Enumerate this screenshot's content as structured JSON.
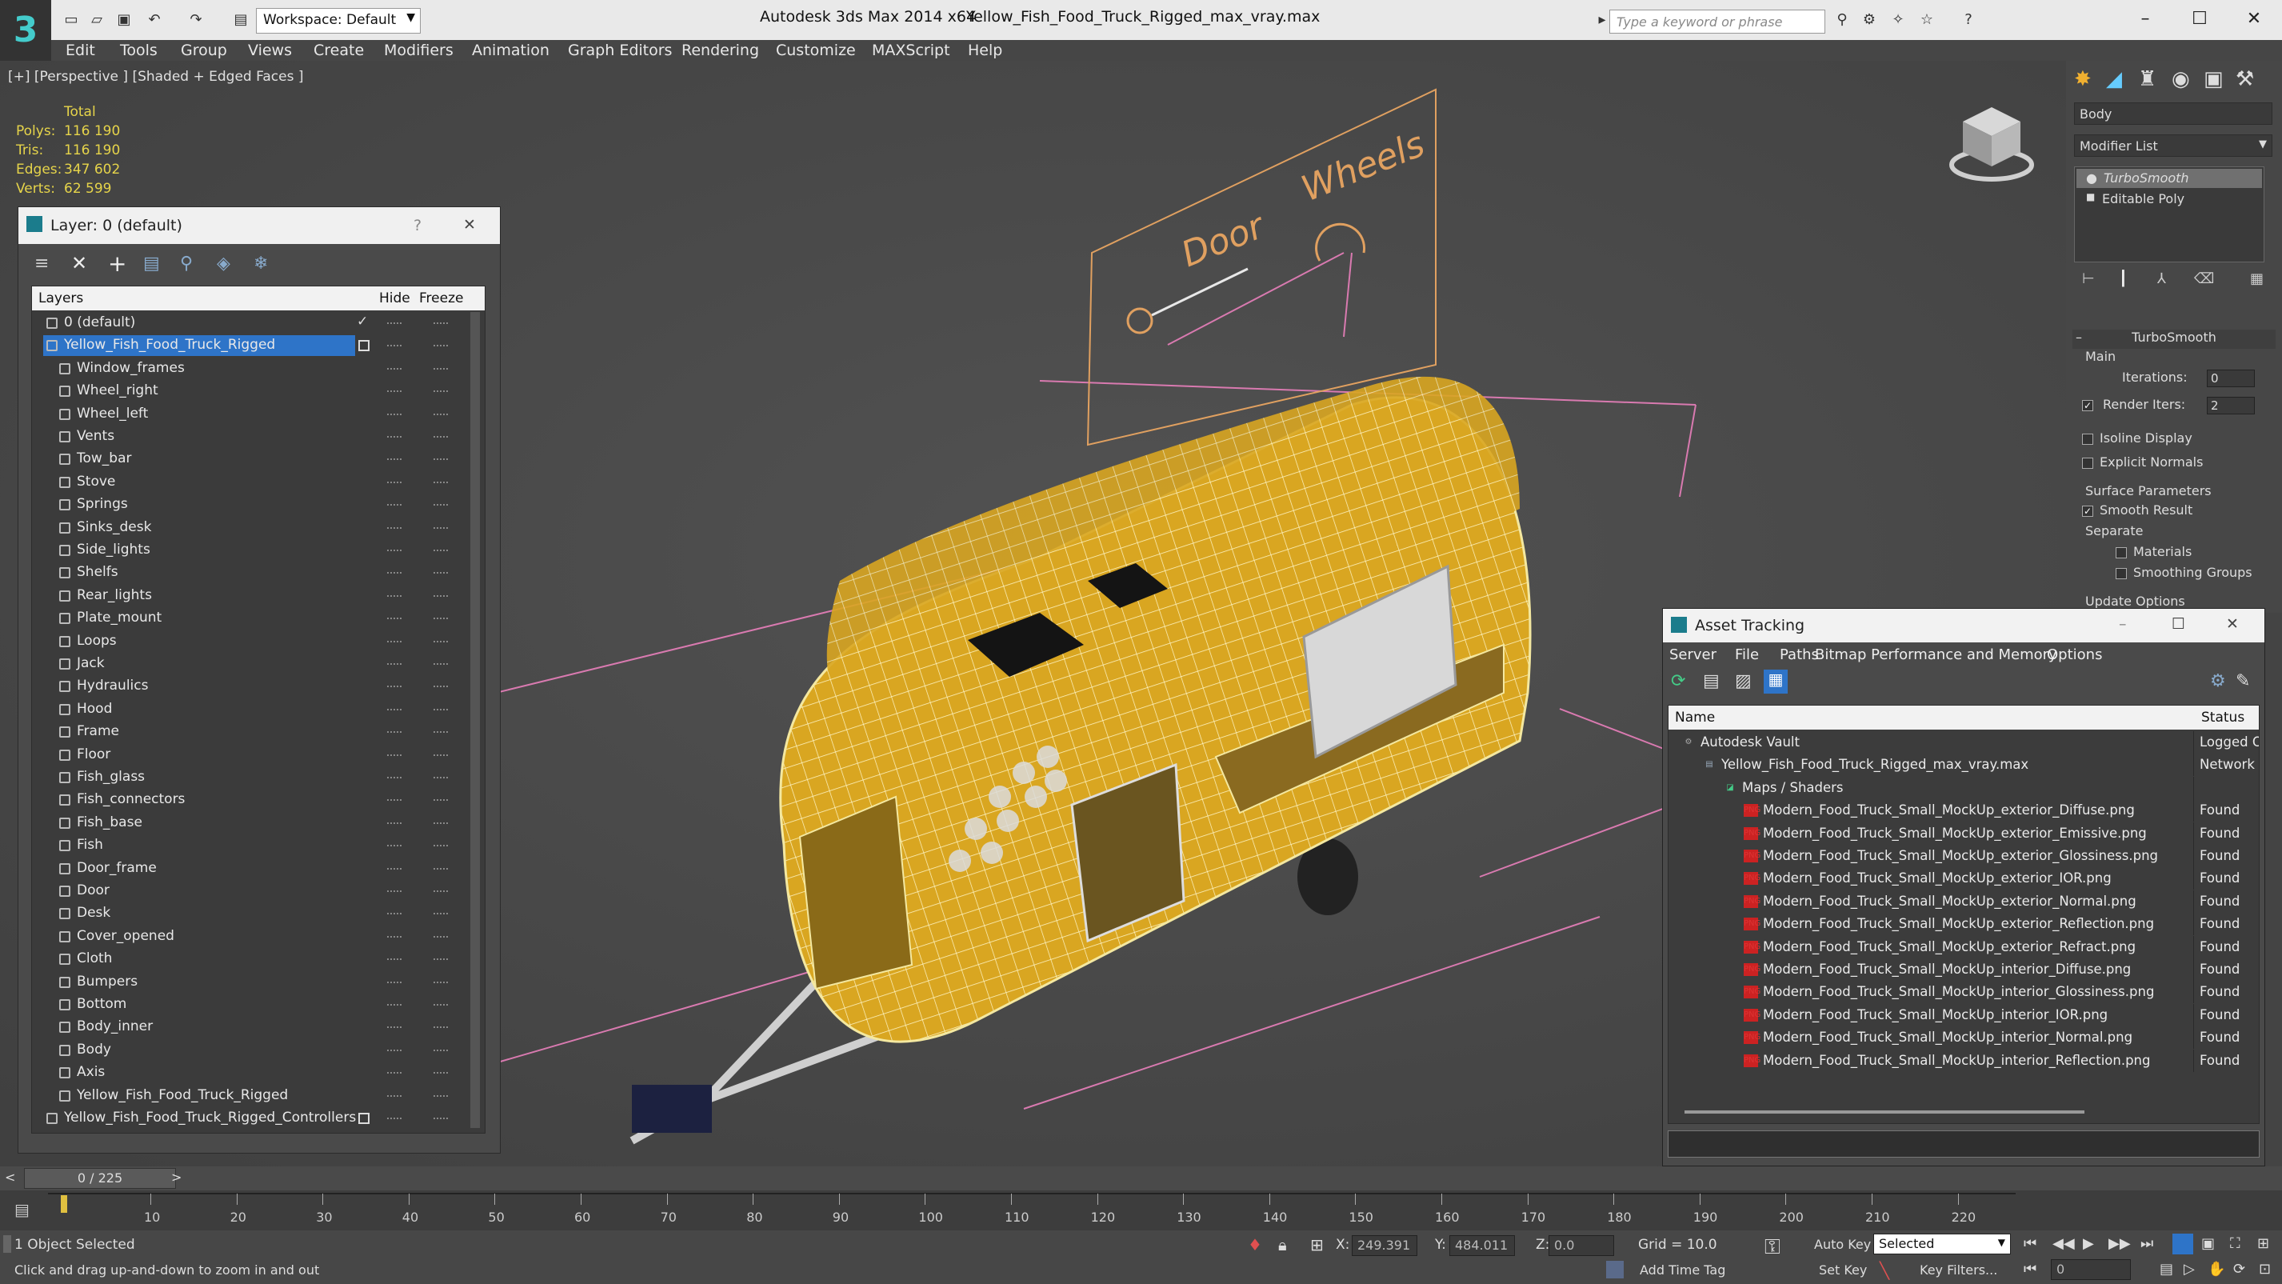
{
  "title_bar": {
    "app": "Autodesk 3ds Max  2014 x64",
    "file": "Yellow_Fish_Food_Truck_Rigged_max_vray.max",
    "workspace": "Workspace: Default",
    "search_placeholder": "Type a keyword or phrase"
  },
  "menu": [
    "Edit",
    "Tools",
    "Group",
    "Views",
    "Create",
    "Modifiers",
    "Animation",
    "Graph Editors",
    "Rendering",
    "Customize",
    "MAXScript",
    "Help"
  ],
  "viewport": {
    "label": "[+] [Perspective ] [Shaded + Edged Faces ]",
    "stats_header": "Total",
    "stats": [
      {
        "k": "Polys:",
        "v": "116 190"
      },
      {
        "k": "Tris:",
        "v": "116 190"
      },
      {
        "k": "Edges:",
        "v": "347 602"
      },
      {
        "k": "Verts:",
        "v": "62 599"
      }
    ],
    "sign_door": "Door",
    "sign_wheels": "Wheels"
  },
  "layer_dialog": {
    "title": "Layer: 0 (default)",
    "help": "?",
    "close": "✕",
    "col_layers": "Layers",
    "col_hide": "Hide",
    "col_freeze": "Freeze",
    "rows": [
      {
        "name": "0 (default)",
        "level": 0,
        "check": "✓"
      },
      {
        "name": "Yellow_Fish_Food_Truck_Rigged",
        "level": 0,
        "selected": true
      },
      {
        "name": "Window_frames",
        "level": 1
      },
      {
        "name": "Wheel_right",
        "level": 1
      },
      {
        "name": "Wheel_left",
        "level": 1
      },
      {
        "name": "Vents",
        "level": 1
      },
      {
        "name": "Tow_bar",
        "level": 1
      },
      {
        "name": "Stove",
        "level": 1
      },
      {
        "name": "Springs",
        "level": 1
      },
      {
        "name": "Sinks_desk",
        "level": 1
      },
      {
        "name": "Side_lights",
        "level": 1
      },
      {
        "name": "Shelfs",
        "level": 1
      },
      {
        "name": "Rear_lights",
        "level": 1
      },
      {
        "name": "Plate_mount",
        "level": 1
      },
      {
        "name": "Loops",
        "level": 1
      },
      {
        "name": "Jack",
        "level": 1
      },
      {
        "name": "Hydraulics",
        "level": 1
      },
      {
        "name": "Hood",
        "level": 1
      },
      {
        "name": "Frame",
        "level": 1
      },
      {
        "name": "Floor",
        "level": 1
      },
      {
        "name": "Fish_glass",
        "level": 1
      },
      {
        "name": "Fish_connectors",
        "level": 1
      },
      {
        "name": "Fish_base",
        "level": 1
      },
      {
        "name": "Fish",
        "level": 1
      },
      {
        "name": "Door_frame",
        "level": 1
      },
      {
        "name": "Door",
        "level": 1
      },
      {
        "name": "Desk",
        "level": 1
      },
      {
        "name": "Cover_opened",
        "level": 1
      },
      {
        "name": "Cloth",
        "level": 1
      },
      {
        "name": "Bumpers",
        "level": 1
      },
      {
        "name": "Bottom",
        "level": 1
      },
      {
        "name": "Body_inner",
        "level": 1
      },
      {
        "name": "Body",
        "level": 1
      },
      {
        "name": "Axis",
        "level": 1
      },
      {
        "name": "Yellow_Fish_Food_Truck_Rigged",
        "level": 1
      },
      {
        "name": "Yellow_Fish_Food_Truck_Rigged_Controllers",
        "level": 0
      }
    ]
  },
  "command_panel": {
    "object_name": "Body",
    "modifier_list": "Modifier List",
    "stack": [
      "TurboSmooth",
      "Editable Poly"
    ],
    "rollout_title": "TurboSmooth",
    "main_label": "Main",
    "iterations_label": "Iterations:",
    "iterations_value": "0",
    "render_iters_label": "Render Iters:",
    "render_iters_value": "2",
    "isoline": "Isoline Display",
    "explicit_normals": "Explicit Normals",
    "surface_params": "Surface Parameters",
    "smooth_result": "Smooth Result",
    "separate": "Separate",
    "materials": "Materials",
    "smoothing_groups": "Smoothing Groups",
    "update_options": "Update Options"
  },
  "asset_tracking": {
    "title": "Asset Tracking",
    "menu": [
      "Server",
      "File",
      "Paths",
      "Bitmap Performance and Memory",
      "Options"
    ],
    "col_name": "Name",
    "col_status": "Status",
    "rows": [
      {
        "name": "Autodesk Vault",
        "status": "Logged O",
        "level": 0
      },
      {
        "name": "Yellow_Fish_Food_Truck_Rigged_max_vray.max",
        "status": "Network P",
        "level": 1
      },
      {
        "name": "Maps / Shaders",
        "status": "",
        "level": 2
      },
      {
        "name": "Modern_Food_Truck_Small_MockUp_exterior_Diffuse.png",
        "status": "Found",
        "level": 3
      },
      {
        "name": "Modern_Food_Truck_Small_MockUp_exterior_Emissive.png",
        "status": "Found",
        "level": 3
      },
      {
        "name": "Modern_Food_Truck_Small_MockUp_exterior_Glossiness.png",
        "status": "Found",
        "level": 3
      },
      {
        "name": "Modern_Food_Truck_Small_MockUp_exterior_IOR.png",
        "status": "Found",
        "level": 3
      },
      {
        "name": "Modern_Food_Truck_Small_MockUp_exterior_Normal.png",
        "status": "Found",
        "level": 3
      },
      {
        "name": "Modern_Food_Truck_Small_MockUp_exterior_Reflection.png",
        "status": "Found",
        "level": 3
      },
      {
        "name": "Modern_Food_Truck_Small_MockUp_exterior_Refract.png",
        "status": "Found",
        "level": 3
      },
      {
        "name": "Modern_Food_Truck_Small_MockUp_interior_Diffuse.png",
        "status": "Found",
        "level": 3
      },
      {
        "name": "Modern_Food_Truck_Small_MockUp_interior_Glossiness.png",
        "status": "Found",
        "level": 3
      },
      {
        "name": "Modern_Food_Truck_Small_MockUp_interior_IOR.png",
        "status": "Found",
        "level": 3
      },
      {
        "name": "Modern_Food_Truck_Small_MockUp_interior_Normal.png",
        "status": "Found",
        "level": 3
      },
      {
        "name": "Modern_Food_Truck_Small_MockUp_interior_Reflection.png",
        "status": "Found",
        "level": 3
      }
    ]
  },
  "timeline": {
    "frame": "0 / 225",
    "prev": "<",
    "next": ">",
    "ticks": [
      "10",
      "20",
      "30",
      "40",
      "50",
      "60",
      "70",
      "80",
      "90",
      "100",
      "110",
      "120",
      "130",
      "140",
      "150",
      "160",
      "170",
      "180",
      "190",
      "200",
      "210",
      "220"
    ]
  },
  "status": {
    "selected": "1 Object Selected",
    "hint": "Click and drag up-and-down to zoom in and out",
    "x_label": "X:",
    "x_value": "249.391",
    "y_label": "Y:",
    "y_value": "484.011",
    "z_label": "Z:",
    "z_value": "0.0",
    "grid": "Grid = 10.0",
    "auto_key": "Auto Key",
    "set_key": "Set Key",
    "selected_dropdown": "Selected",
    "key_filters": "Key Filters...",
    "add_time_tag": "Add Time Tag",
    "frame_field": "0"
  },
  "colors": {
    "truck_yellow": "#d9a621",
    "selection_blue": "#2e74c8",
    "wire_pink": "#d97ab0",
    "sign_orange": "#e0a060",
    "stats_yellow": "#e6d44a"
  }
}
